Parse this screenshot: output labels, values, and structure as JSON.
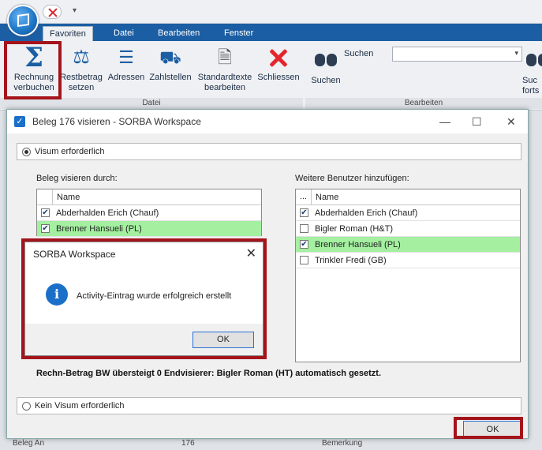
{
  "app": {
    "qat_dropdown": "▾",
    "tabs": [
      "Favoriten",
      "Datei",
      "Bearbeiten",
      "Fenster"
    ],
    "ribbon": {
      "buttons": [
        {
          "label": "Rechnung verbuchen"
        },
        {
          "label": "Restbetrag setzen"
        },
        {
          "label": "Adressen"
        },
        {
          "label": "Zahlstellen"
        },
        {
          "label": "Standardtexte bearbeiten"
        },
        {
          "label": "Schliessen"
        },
        {
          "label": "Suchen"
        },
        {
          "label": "Suc forts"
        }
      ],
      "groups": [
        "Datei",
        "Bearbeiten"
      ],
      "search_label": "Suchen",
      "search_value": ""
    },
    "bottom": {
      "left": "Beleg An",
      "value": "176",
      "right": "Bemerkung"
    }
  },
  "dialog": {
    "title": "Beleg 176 visieren - SORBA Workspace",
    "visum_required": "Visum erforderlich",
    "no_visum": "Kein Visum erforderlich",
    "left_label": "Beleg visieren durch:",
    "right_label": "Weitere Benutzer hinzufügen:",
    "col_name": "Name",
    "col_check": "...",
    "left_rows": [
      {
        "name": "Abderhalden Erich (Chauf)",
        "checked": true,
        "selected": false
      },
      {
        "name": "Brenner Hansueli (PL)",
        "checked": true,
        "selected": true
      }
    ],
    "right_rows": [
      {
        "name": "Abderhalden Erich (Chauf)",
        "checked": true,
        "selected": false
      },
      {
        "name": "Bigler Roman (H&T)",
        "checked": false,
        "selected": false
      },
      {
        "name": "Brenner Hansueli (PL)",
        "checked": true,
        "selected": true
      },
      {
        "name": "Trinkler Fredi (GB)",
        "checked": false,
        "selected": false
      }
    ],
    "info_text": "Rechn-Betrag BW übersteigt 0 Endvisierer: Bigler Roman (HT) automatisch gesetzt.",
    "ok": "OK"
  },
  "msgbox": {
    "title": "SORBA Workspace",
    "text": "Activity-Eintrag wurde erfolgreich erstellt",
    "ok": "OK"
  },
  "colors": {
    "accent": "#1b5ea3",
    "highlight": "#a4f0a0",
    "callout": "#a5141b"
  }
}
